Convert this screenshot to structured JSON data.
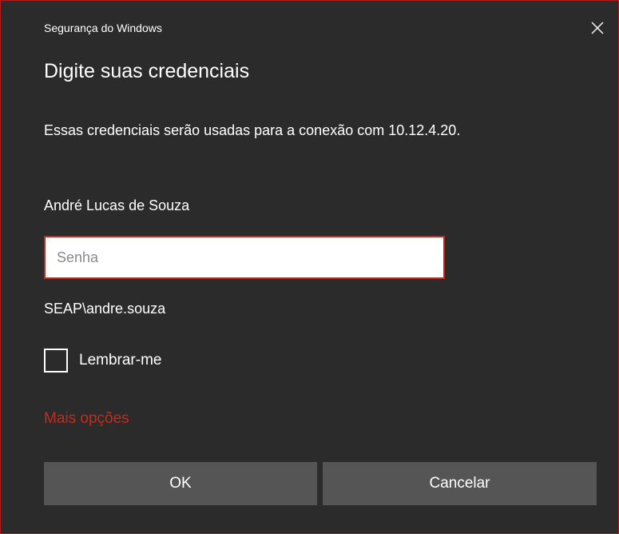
{
  "dialog": {
    "caption": "Segurança do Windows",
    "close_icon": "close-icon",
    "heading": "Digite suas credenciais",
    "description": "Essas credenciais serão usadas para a conexão com 10.12.4.20.",
    "username": "André Lucas de Souza",
    "password": {
      "placeholder": "Senha",
      "value": ""
    },
    "domain_user": "SEAP\\andre.souza",
    "remember": {
      "label": "Lembrar-me",
      "checked": false
    },
    "more_options": "Mais opções",
    "buttons": {
      "ok": "OK",
      "cancel": "Cancelar"
    }
  },
  "colors": {
    "background": "#2b2b2b",
    "border": "#b11b1b",
    "accent_red": "#c42b1c",
    "button_bg": "#555555",
    "text": "#ffffff"
  }
}
